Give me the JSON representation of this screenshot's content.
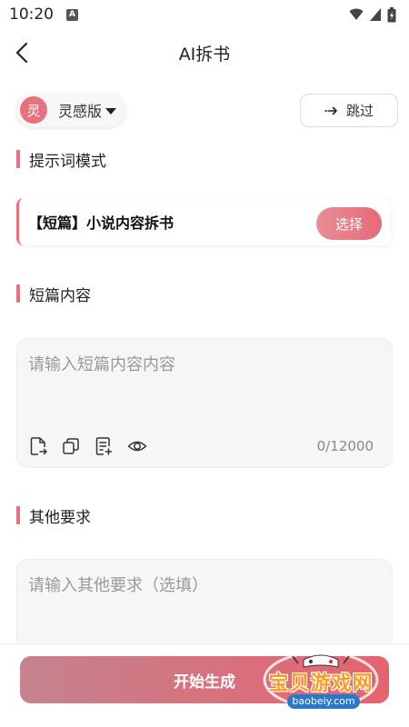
{
  "status_bar": {
    "time": "10:20",
    "a_badge": "A"
  },
  "header": {
    "title": "AI拆书"
  },
  "mode": {
    "avatar_char": "灵",
    "label": "灵感版"
  },
  "skip": {
    "label": "跳过"
  },
  "sections": {
    "prompt_mode": "提示词模式",
    "short_content": "短篇内容",
    "other_requirements": "其他要求"
  },
  "template": {
    "title": "【短篇】小说内容拆书",
    "select_label": "选择"
  },
  "content_input": {
    "placeholder": "请输入短篇内容内容",
    "char_count": "0/12000"
  },
  "requirements_input": {
    "placeholder": "请输入其他要求（选填）"
  },
  "start_button": {
    "label": "开始生成"
  },
  "watermark": {
    "text": "宝贝游戏网",
    "url": "baobeiy.com"
  },
  "colors": {
    "accent": "#e6727e",
    "button_gradient_start": "#c4838e",
    "button_gradient_end": "#e5636f"
  }
}
